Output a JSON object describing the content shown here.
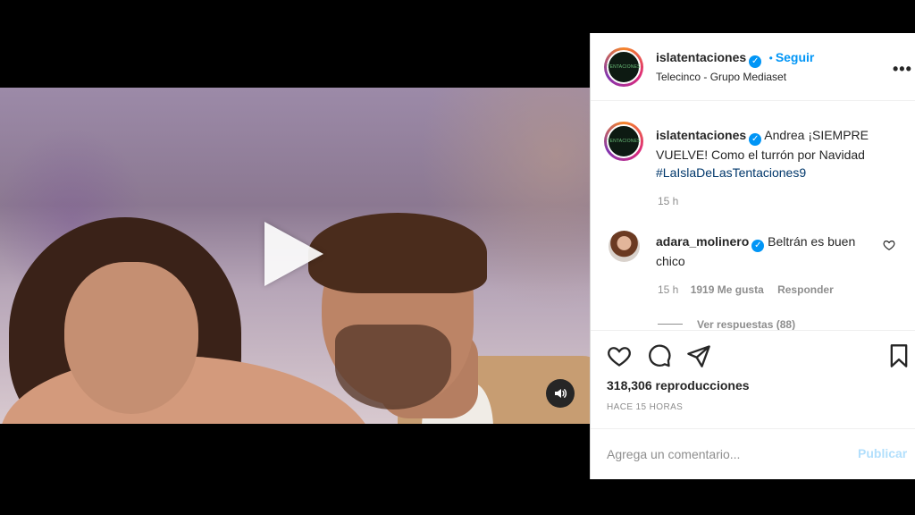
{
  "post": {
    "username": "islatentaciones",
    "follow_label": "Seguir",
    "separator": "•",
    "subtitle": "Telecinco - Grupo Mediaset",
    "avatar_text": "TENTACIONES"
  },
  "caption": {
    "username": "islatentaciones",
    "text": "Andrea ¡SIEMPRE VUELVE! Como el turrón por Navidad",
    "hashtag": "#LaIslaDeLasTentaciones9",
    "time": "15 h"
  },
  "comment": {
    "username": "adara_molinero",
    "text": "Beltrán es buen chico",
    "time": "15 h",
    "likes": "1919 Me gusta",
    "reply_label": "Responder",
    "view_replies": "Ver respuestas (88)"
  },
  "stats": {
    "views": "318,306 reproducciones",
    "time_ago": "HACE 15 HORAS"
  },
  "comment_box": {
    "placeholder": "Agrega un comentario...",
    "publish_label": "Publicar"
  },
  "colors": {
    "accent": "#0095f6",
    "hashtag": "#00376b",
    "muted": "#8e8e8e",
    "publish_disabled": "#b2dffc"
  },
  "icons": [
    "play-icon",
    "mute-icon",
    "more-icon",
    "heart-icon",
    "comment-icon",
    "share-icon",
    "save-icon",
    "verified-icon"
  ]
}
